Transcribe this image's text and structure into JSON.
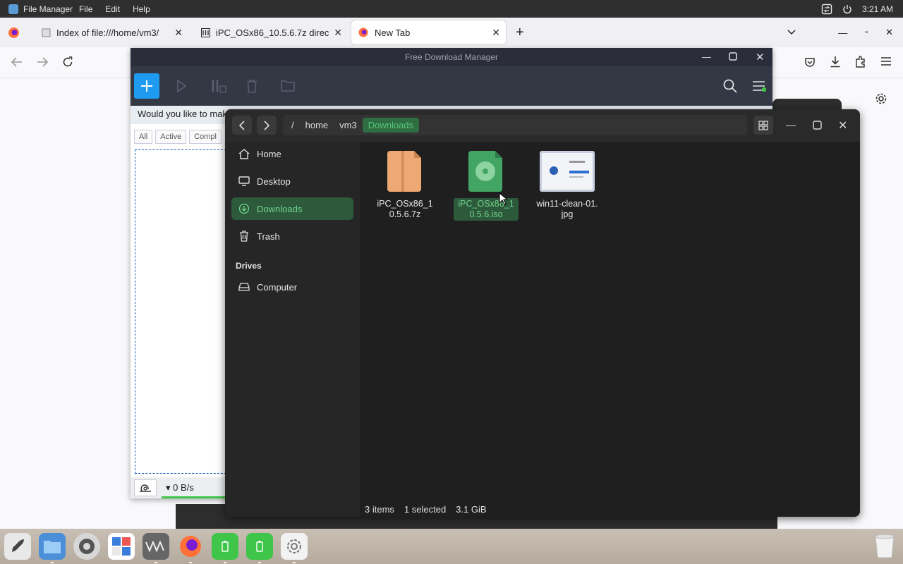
{
  "topbar": {
    "app_name": "File Manager",
    "menus": [
      "File",
      "Edit",
      "Help"
    ],
    "clock": "3:21 AM"
  },
  "browser": {
    "tabs": [
      {
        "label": "Index of file:///home/vm3/",
        "icon": "page-icon"
      },
      {
        "label": "iPC_OSx86_10.5.6.7z direc",
        "icon": "archive-site-icon"
      },
      {
        "label": "New Tab",
        "icon": "firefox-icon"
      }
    ],
    "new_tab_label": "+"
  },
  "fdm": {
    "title": "Free Download Manager",
    "banner": "Would you like to mak",
    "filters": [
      "All",
      "Active",
      "Compl"
    ],
    "speed": "▾ 0 B/s",
    "colors": {
      "accent": "#1e9bf0",
      "toolbar": "#333845"
    }
  },
  "files": {
    "breadcrumbs": [
      "/",
      "home",
      "vm3",
      "Downloads"
    ],
    "sidebar": {
      "places": [
        {
          "label": "Home",
          "icon": "home-icon"
        },
        {
          "label": "Desktop",
          "icon": "desktop-icon"
        },
        {
          "label": "Downloads",
          "icon": "download-icon",
          "selected": true
        },
        {
          "label": "Trash",
          "icon": "trash-icon"
        }
      ],
      "drives_heading": "Drives",
      "drives": [
        {
          "label": "Computer",
          "icon": "drive-icon"
        }
      ]
    },
    "items": [
      {
        "name": "iPC_OSx86_10.5.6.7z",
        "icon": "archive-file-icon",
        "selected": false
      },
      {
        "name": "iPC_OSx86_10.5.6.iso",
        "icon": "disc-image-icon",
        "selected": true
      },
      {
        "name": "win11-clean-01.jpg",
        "icon": "image-thumbnail",
        "selected": false
      }
    ],
    "status": {
      "count": "3 items",
      "selection": "1 selected",
      "size": "3.1 GiB"
    },
    "colors": {
      "selection_bg": "#2e5a3c",
      "selection_fg": "#6fd48d"
    }
  },
  "dock": {
    "apps": [
      "rocket-launcher-icon",
      "files-icon",
      "settings-icon",
      "calculator-icon",
      "vmware-icon",
      "firefox-icon",
      "battery-app-icon",
      "battery-app-icon",
      "system-gear-icon"
    ],
    "trash": "trash-can-icon"
  }
}
